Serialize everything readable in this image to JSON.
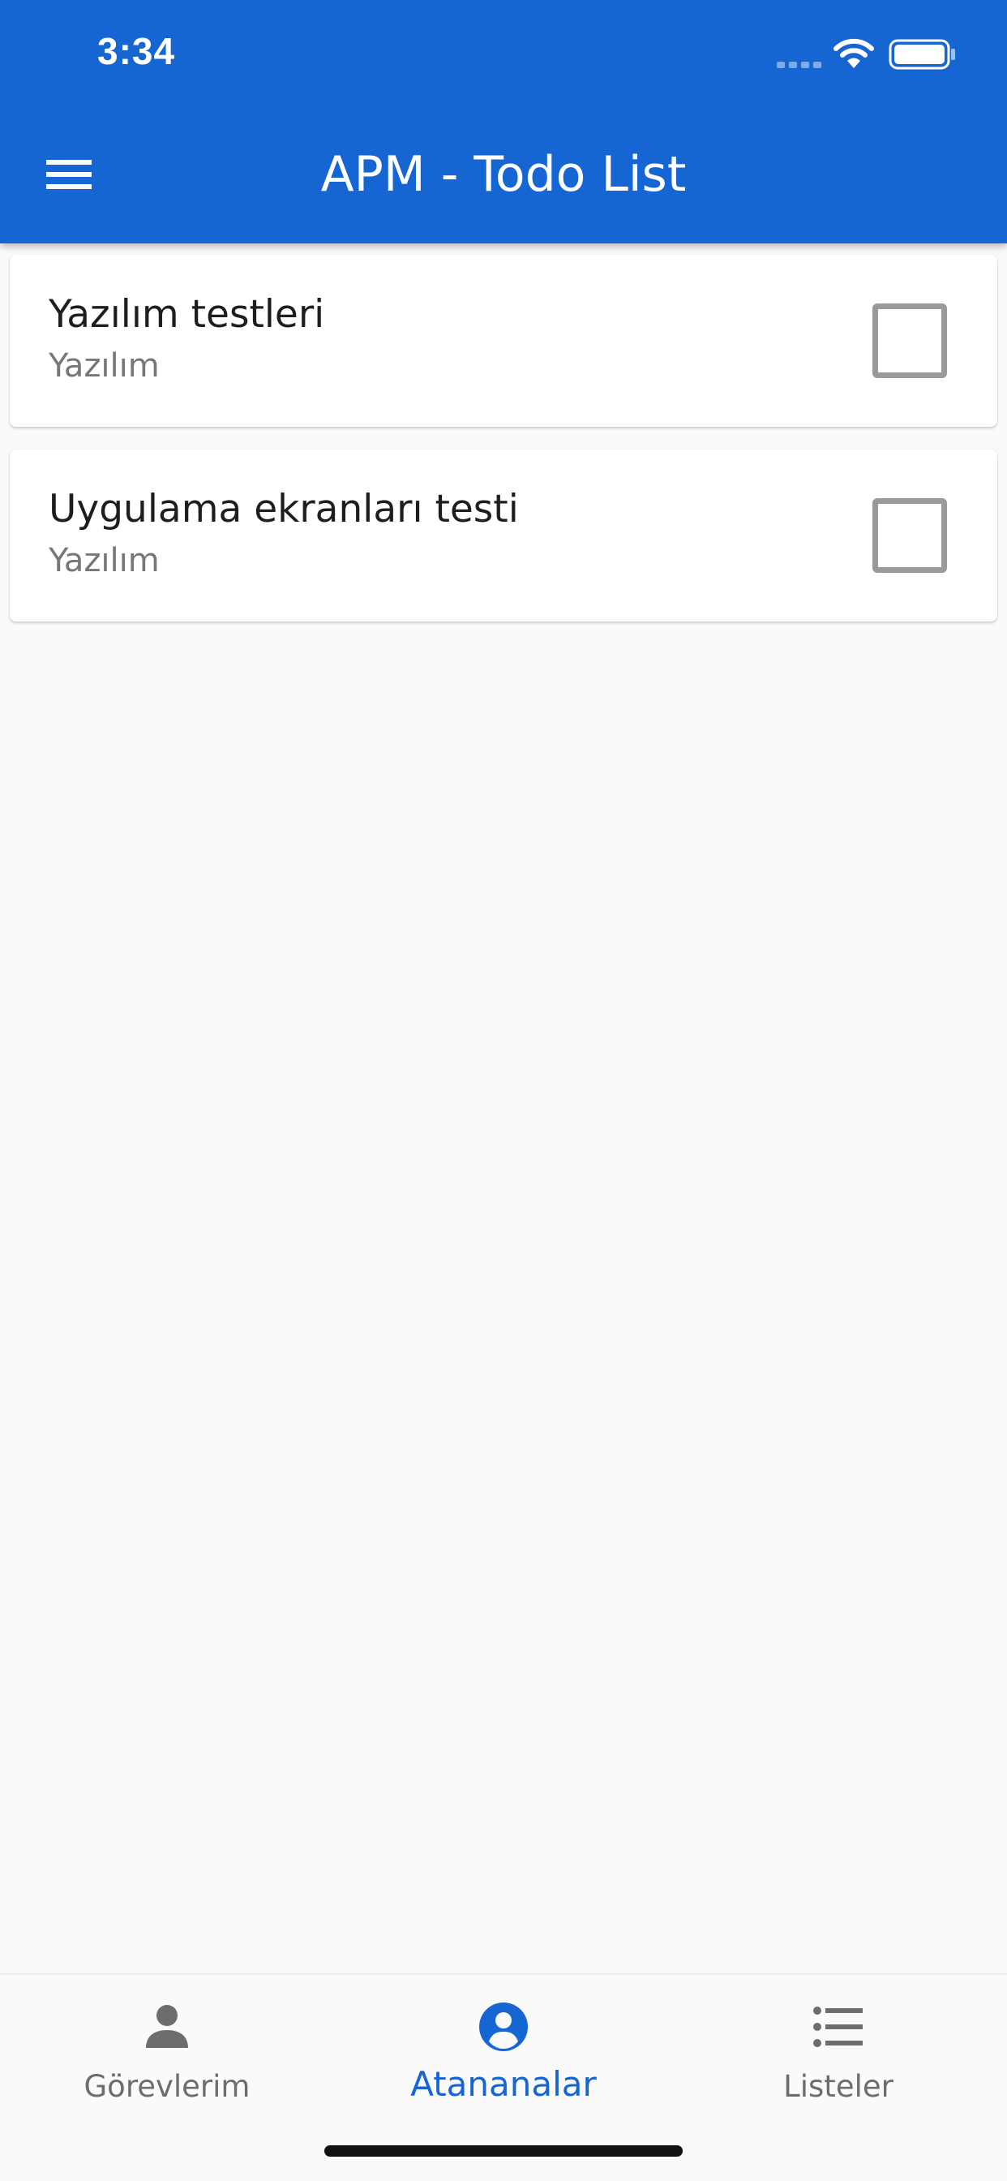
{
  "status_bar": {
    "time": "3:34",
    "icons": [
      "cellular-signal-icon",
      "wifi-icon",
      "battery-icon"
    ]
  },
  "app_bar": {
    "title": "APM - Todo List",
    "menu_icon": "hamburger-menu-icon",
    "background": "#1565d3"
  },
  "tasks": [
    {
      "title": "Yazılım testleri",
      "list": "Yazılım",
      "checked": false
    },
    {
      "title": "Uygulama ekranları testi",
      "list": "Yazılım",
      "checked": false
    }
  ],
  "bottom_nav": {
    "active_color": "#1565d3",
    "inactive_color": "#6d6d6d",
    "items": [
      {
        "label": "Görevlerim",
        "icon": "person-icon",
        "active": false
      },
      {
        "label": "Atananalar",
        "icon": "account-circle-icon",
        "active": true
      },
      {
        "label": "Listeler",
        "icon": "list-icon",
        "active": false
      }
    ]
  }
}
